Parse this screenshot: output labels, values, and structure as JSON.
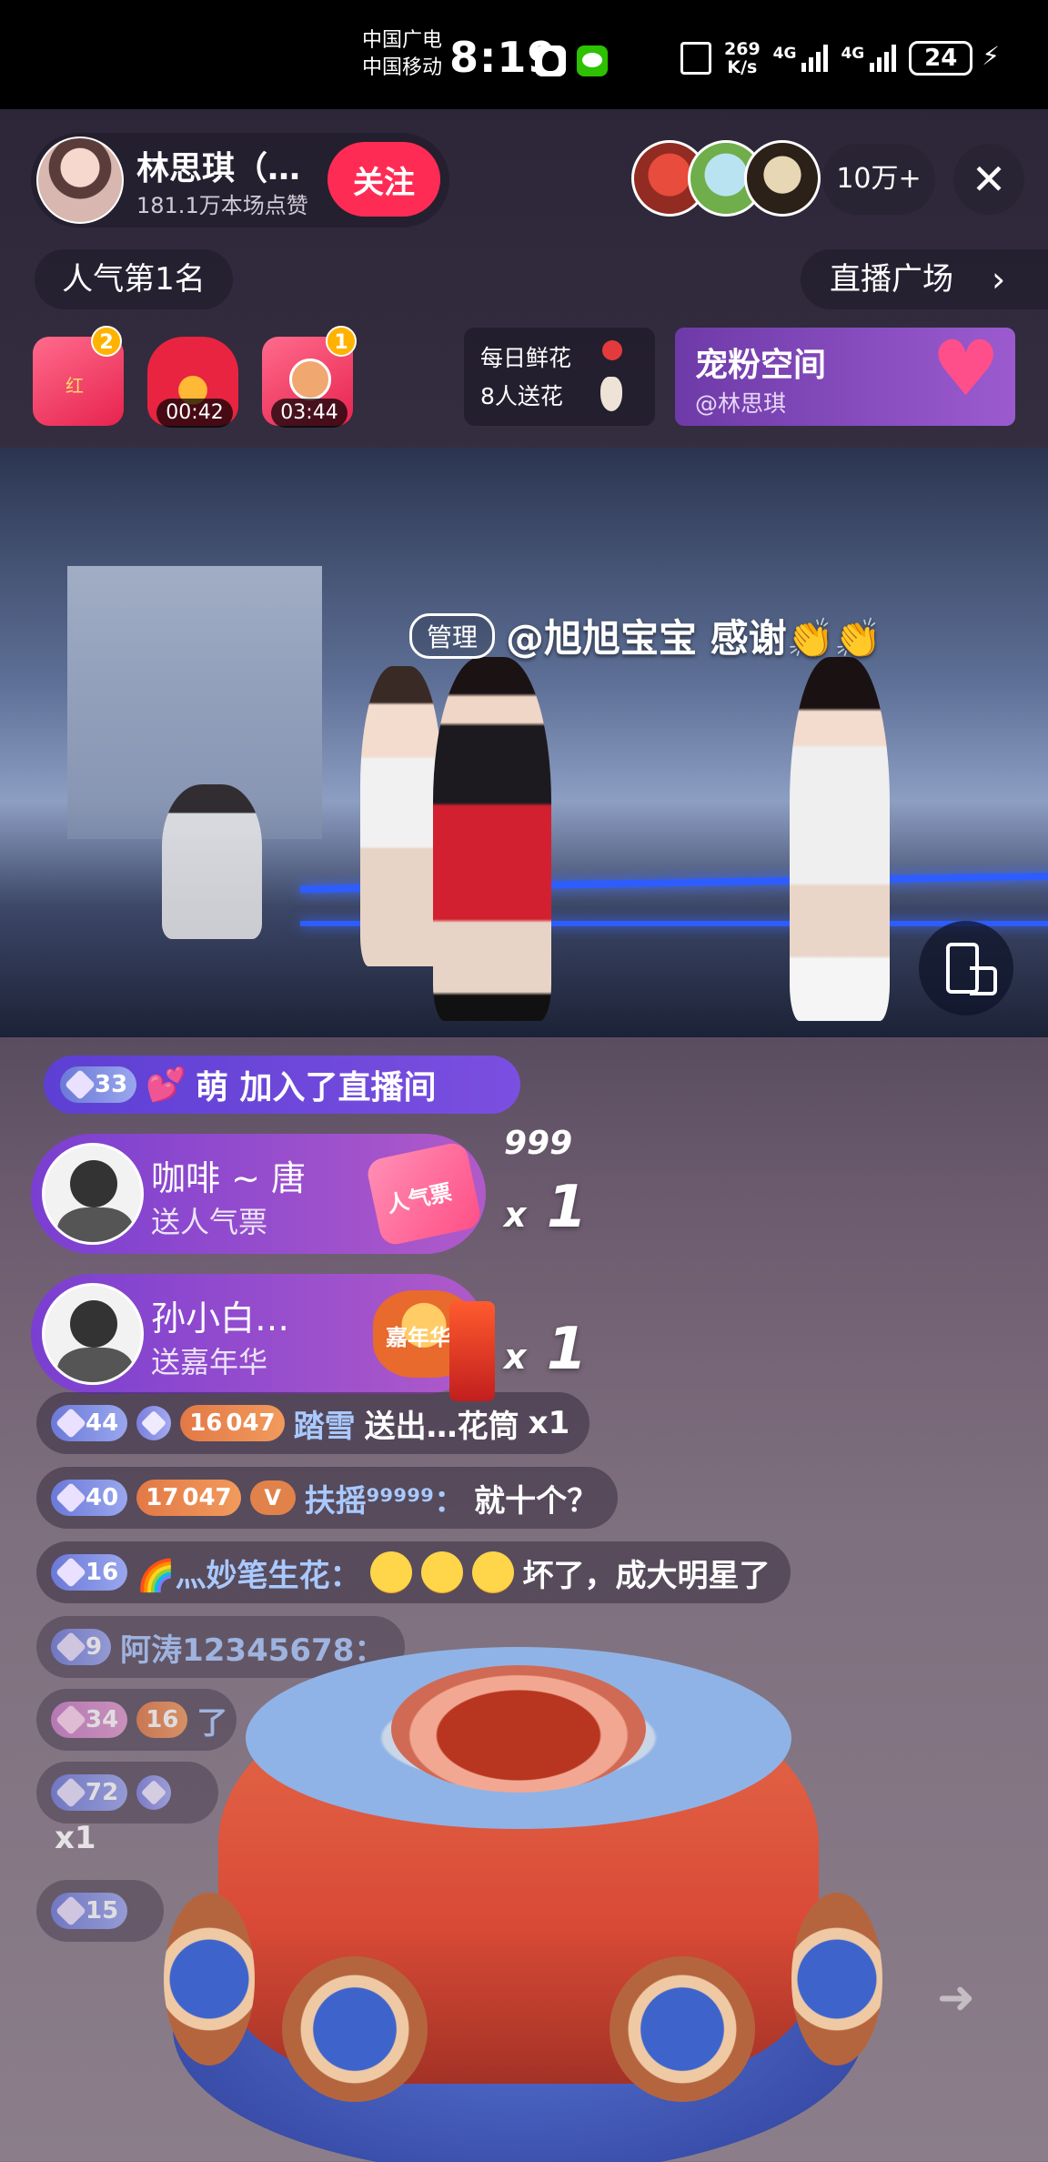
{
  "status_bar": {
    "carrier_1": "中国广电",
    "carrier_2": "中国移动",
    "time": "8:19",
    "net_speed_value": "269",
    "net_speed_unit": "K/s",
    "network_1": "4G",
    "network_2": "4G",
    "battery": "24"
  },
  "header": {
    "host_name": "林思琪（…",
    "host_likes": "181.1万本场点赞",
    "follow_label": "关注",
    "viewer_count": "10万+",
    "close_label": "✕",
    "rank_label": "人气第1名",
    "plaza_label": "直播广场",
    "plaza_chevron": "›"
  },
  "gifts_row": {
    "redpack_1_badge": "2",
    "redpack_2_timer": "00:42",
    "redpack_3_badge": "1",
    "redpack_3_timer": "03:44",
    "flower_title": "每日鲜花",
    "flower_count": "8人送花",
    "fan_space_title": "宠粉空间",
    "fan_space_handle": "@林思琪"
  },
  "video": {
    "manager_tag": "管理",
    "manager_message": "@旭旭宝宝 感谢👏👏"
  },
  "chat": {
    "join": {
      "level": "33",
      "name": "萌",
      "text": "萌 加入了直播间"
    },
    "gift_1": {
      "user": "咖啡 ~ 唐",
      "action": "送人气票",
      "gift_name": "人气票",
      "combo_top": "999",
      "combo": "1"
    },
    "gift_2": {
      "user": "孙小白…",
      "action": "送嘉年华",
      "gift_name": "嘉年华",
      "combo": "1"
    },
    "rows": [
      {
        "level": "44",
        "fan_level": "16",
        "fan_id": "047",
        "user": "踏雪",
        "message": "送出…花筒",
        "count": "x1"
      },
      {
        "level": "40",
        "fan_level": "17",
        "fan_id": "047",
        "user": "扶摇⁹⁹⁹⁹⁹：",
        "message": "就十个？"
      },
      {
        "level": "16",
        "user": "🌈灬妙笔生花：",
        "message": "坏了，成大明星了"
      },
      {
        "level": "9",
        "user": "阿涛12345678："
      },
      {
        "level": "34",
        "fan_level": "16",
        "user": "了"
      },
      {
        "level": "72",
        "count": "x1"
      },
      {
        "level": "15"
      }
    ]
  },
  "colors": {
    "follow": "#fe2c55",
    "fan_space": "#7b45c0",
    "join_bar": "#5d3fd3",
    "username": "#a9c9ff"
  }
}
